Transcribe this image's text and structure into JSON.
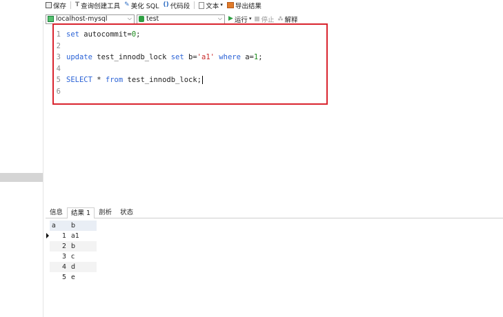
{
  "toolbar": {
    "save": "保存",
    "query_builder": "查询创建工具",
    "beautify_sql": "美化 SQL",
    "code_snippet": "代码段",
    "text": "文本",
    "export_result": "导出结果"
  },
  "connection_bar": {
    "connection": "localhost-mysql",
    "database": "test",
    "run": "运行",
    "stop": "停止",
    "explain": "解释"
  },
  "editor": {
    "lines": [
      {
        "num": "1",
        "tokens": [
          {
            "t": "kw",
            "v": "set"
          },
          {
            "t": "plain",
            "v": " autocommit="
          },
          {
            "t": "num",
            "v": "0"
          },
          {
            "t": "plain",
            "v": ";"
          }
        ]
      },
      {
        "num": "2",
        "tokens": []
      },
      {
        "num": "3",
        "tokens": [
          {
            "t": "kw",
            "v": "update"
          },
          {
            "t": "plain",
            "v": " test_innodb_lock "
          },
          {
            "t": "kw",
            "v": "set"
          },
          {
            "t": "plain",
            "v": " b="
          },
          {
            "t": "str",
            "v": "'a1'"
          },
          {
            "t": "plain",
            "v": " "
          },
          {
            "t": "kw",
            "v": "where"
          },
          {
            "t": "plain",
            "v": " a="
          },
          {
            "t": "num",
            "v": "1"
          },
          {
            "t": "plain",
            "v": ";"
          }
        ]
      },
      {
        "num": "4",
        "tokens": []
      },
      {
        "num": "5",
        "tokens": [
          {
            "t": "kw",
            "v": "SELECT"
          },
          {
            "t": "plain",
            "v": " * "
          },
          {
            "t": "kw",
            "v": "from"
          },
          {
            "t": "plain",
            "v": " test_innodb_lock;"
          }
        ]
      },
      {
        "num": "6",
        "tokens": []
      }
    ],
    "cursor_line": 5
  },
  "result_tabs": {
    "info": "信息",
    "result1": "结果 1",
    "profile": "剖析",
    "status": "状态"
  },
  "grid": {
    "columns": [
      "a",
      "b"
    ],
    "rows": [
      [
        "1",
        "a1"
      ],
      [
        "2",
        "b"
      ],
      [
        "3",
        "c"
      ],
      [
        "4",
        "d"
      ],
      [
        "5",
        "e"
      ]
    ],
    "current_row": 0
  },
  "colors": {
    "keyword": "#2a62d6",
    "number": "#1a8a1a",
    "string": "#c92a2a",
    "highlight_box": "#d9232d"
  }
}
